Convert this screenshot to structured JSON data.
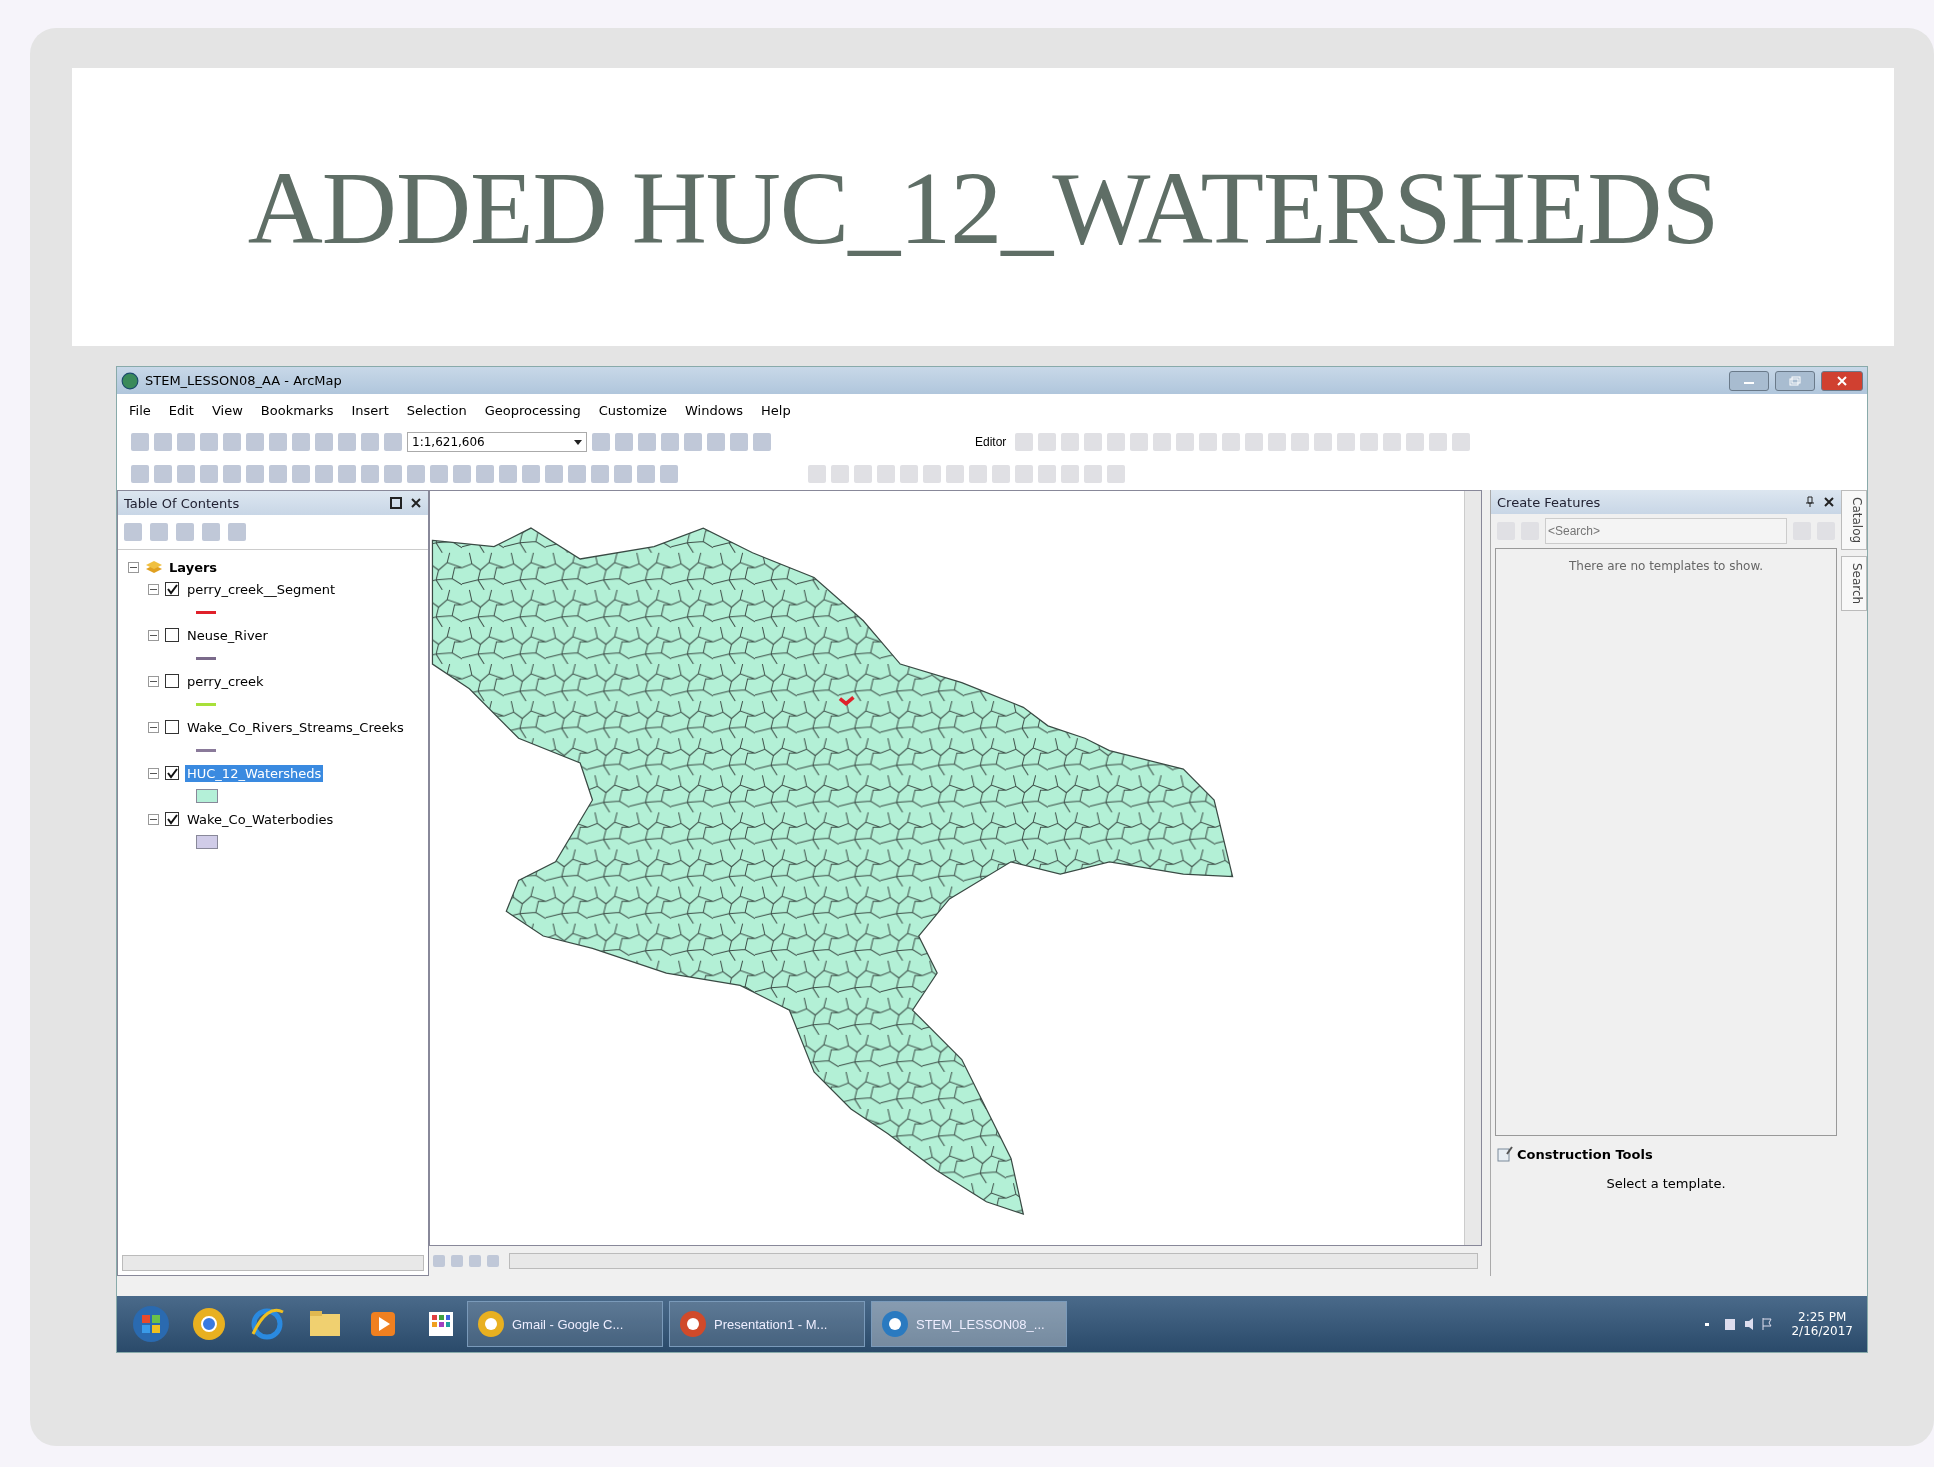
{
  "slide": {
    "title": "ADDED HUC_12_WATERSHEDS"
  },
  "window": {
    "title": "STEM_LESSON08_AA - ArcMap"
  },
  "menu": [
    "File",
    "Edit",
    "View",
    "Bookmarks",
    "Insert",
    "Selection",
    "Geoprocessing",
    "Customize",
    "Windows",
    "Help"
  ],
  "toolbar": {
    "scale": "1:1,621,606",
    "editor": "Editor"
  },
  "toc": {
    "title": "Table Of Contents",
    "root": {
      "label": "Layers",
      "expanded": true,
      "children": [
        {
          "label": "perry_creek__Segment",
          "checked": true,
          "selected": false,
          "expanded": true,
          "kind": "line",
          "color": "#e0202a"
        },
        {
          "label": "Neuse_River",
          "checked": false,
          "selected": false,
          "expanded": true,
          "kind": "line",
          "color": "#7a6a8a"
        },
        {
          "label": "perry_creek",
          "checked": false,
          "selected": false,
          "expanded": true,
          "kind": "line",
          "color": "#a8e03a"
        },
        {
          "label": "Wake_Co_Rivers_Streams_Creeks",
          "checked": false,
          "selected": false,
          "expanded": true,
          "kind": "line",
          "color": "#8a7a9a"
        },
        {
          "label": "HUC_12_Watersheds",
          "checked": true,
          "selected": true,
          "expanded": true,
          "kind": "fill",
          "color": "#b4f0d8"
        },
        {
          "label": "Wake_Co_Waterbodies",
          "checked": true,
          "selected": false,
          "expanded": true,
          "kind": "fill",
          "color": "#d0cce8"
        }
      ]
    }
  },
  "create_features": {
    "title": "Create Features",
    "placeholder": "<Search>",
    "message": "There are no templates to show."
  },
  "construction_tools": {
    "title": "Construction Tools",
    "message": "Select a template."
  },
  "side_tabs": [
    "Catalog",
    "Search"
  ],
  "taskbar": {
    "buttons": [
      {
        "label": "Gmail - Google C...",
        "kind": "browser",
        "selected": false
      },
      {
        "label": "Presentation1 - M...",
        "kind": "slides",
        "selected": false
      },
      {
        "label": "STEM_LESSON08_...",
        "kind": "map",
        "selected": true
      }
    ],
    "time": "2:25 PM",
    "date": "2/16/2017"
  }
}
